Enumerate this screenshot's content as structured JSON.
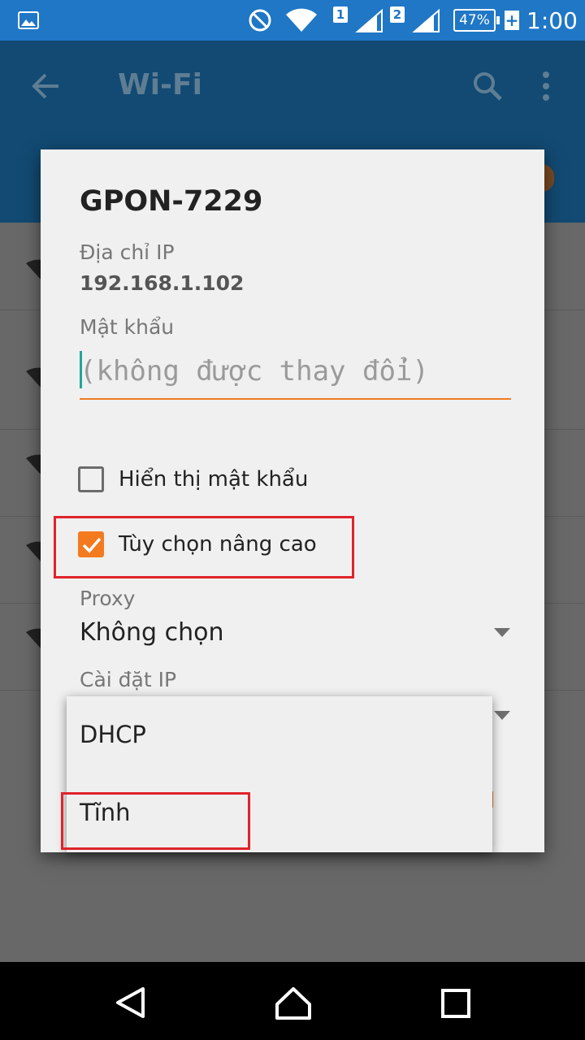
{
  "status_bar": {
    "battery": "47%",
    "time": "1:00",
    "sim1": "1",
    "sim2": "2"
  },
  "toolbar": {
    "title": "Wi-Fi"
  },
  "dialog": {
    "title": "GPON-7229",
    "ip_label": "Địa chỉ IP",
    "ip_value": "192.168.1.102",
    "password_label": "Mật khẩu",
    "password_placeholder": "(không được thay đổi)",
    "show_password": {
      "label": "Hiển thị mật khẩu",
      "checked": false
    },
    "advanced_options": {
      "label": "Tùy chọn nâng cao",
      "checked": true
    },
    "proxy_label": "Proxy",
    "proxy_value": "Không chọn",
    "ip_settings_label": "Cài đặt IP"
  },
  "ip_settings_menu": {
    "options": [
      "DHCP",
      "Tĩnh"
    ]
  },
  "colors": {
    "accent": "#f47a20",
    "highlight": "#e0232a",
    "toolbar": "#124a73",
    "status_bar": "#1f77c6"
  }
}
